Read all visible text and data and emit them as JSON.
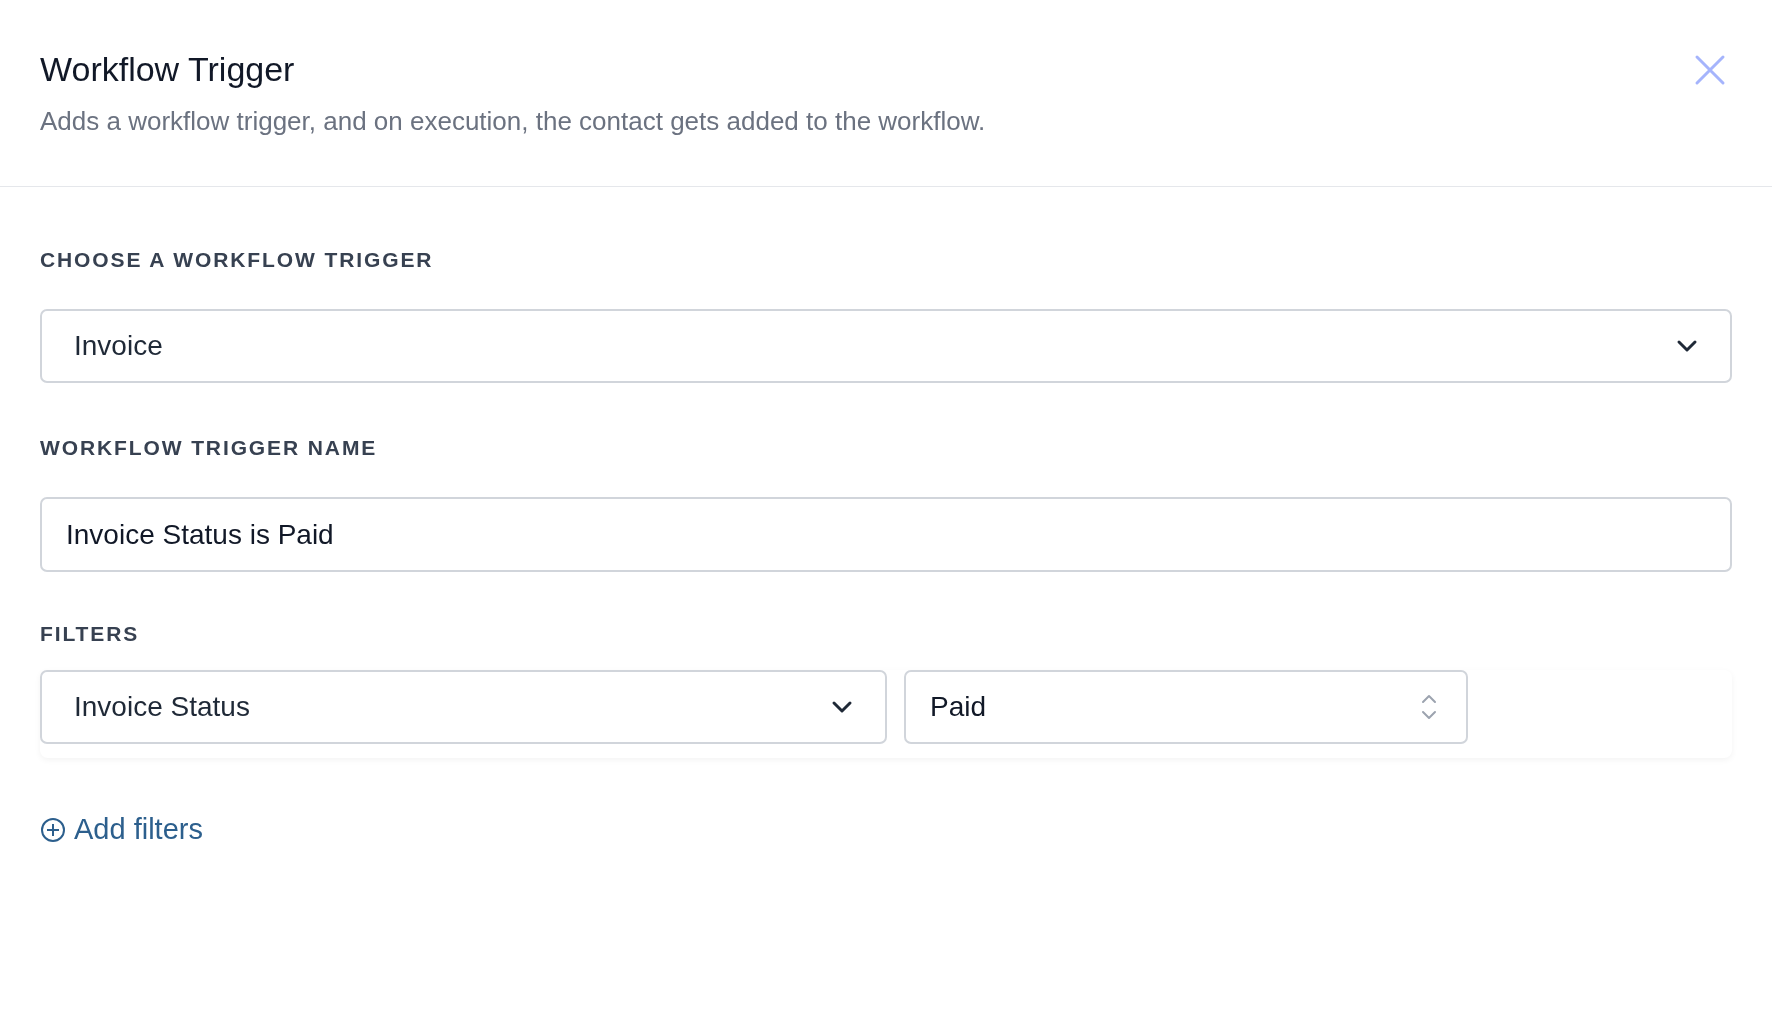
{
  "header": {
    "title": "Workflow Trigger",
    "description": "Adds a workflow trigger, and on execution, the contact gets added to the workflow."
  },
  "trigger_select": {
    "label": "CHOOSE A WORKFLOW TRIGGER",
    "value": "Invoice"
  },
  "trigger_name": {
    "label": "WORKFLOW TRIGGER NAME",
    "value": "Invoice Status is Paid"
  },
  "filters": {
    "label": "FILTERS",
    "rows": [
      {
        "field": "Invoice Status",
        "value": "Paid"
      }
    ]
  },
  "add_filters": "Add filters"
}
